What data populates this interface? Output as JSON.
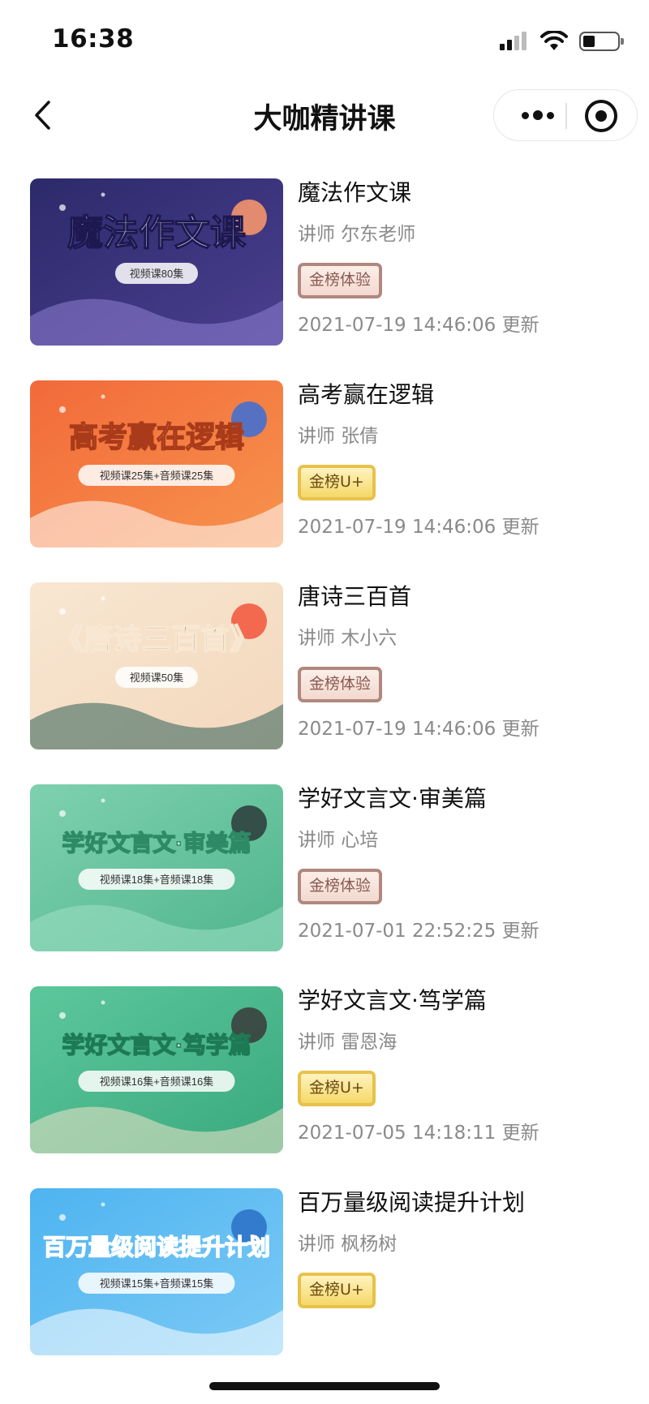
{
  "status_bar": {
    "time": "16:38"
  },
  "nav": {
    "title": "大咖精讲课"
  },
  "courses": [
    {
      "title": "魔法作文课",
      "teacher": "讲师 尔东老师",
      "badge": "金榜体验",
      "badge_type": "trial",
      "updated": "2021-07-19 14:46:06 更新",
      "cover_text": "魔法作文课",
      "cover_sub": "视频课80集",
      "theme": "night"
    },
    {
      "title": "高考赢在逻辑",
      "teacher": "讲师 张倩",
      "badge": "金榜U+",
      "badge_type": "plus",
      "updated": "2021-07-19 14:46:06 更新",
      "cover_text": "高考赢在逻辑",
      "cover_sub": "视频课25集+音频课25集",
      "theme": "orange"
    },
    {
      "title": "唐诗三百首",
      "teacher": "讲师 木小六",
      "badge": "金榜体验",
      "badge_type": "trial",
      "updated": "2021-07-19 14:46:06 更新",
      "cover_text": "《唐诗三百首》",
      "cover_sub": "视频课50集",
      "theme": "cream"
    },
    {
      "title": "学好文言文·审美篇",
      "teacher": "讲师 心培",
      "badge": "金榜体验",
      "badge_type": "trial",
      "updated": "2021-07-01 22:52:25 更新",
      "cover_text": "学好文言文·审美篇",
      "cover_sub": "视频课18集+音频课18集",
      "theme": "mint"
    },
    {
      "title": "学好文言文·笃学篇",
      "teacher": "讲师 雷恩海",
      "badge": "金榜U+",
      "badge_type": "plus",
      "updated": "2021-07-05 14:18:11 更新",
      "cover_text": "学好文言文·笃学篇",
      "cover_sub": "视频课16集+音频课16集",
      "theme": "green"
    },
    {
      "title": "百万量级阅读提升计划",
      "teacher": "讲师 枫杨树",
      "badge": "金榜U+",
      "badge_type": "plus",
      "updated": "",
      "cover_text": "百万量级阅读提升计划",
      "cover_sub": "视频课15集+音频课15集",
      "theme": "blue"
    }
  ],
  "colors": {
    "text_primary": "#111111",
    "text_secondary": "#8a8a8a",
    "badge_trial_border": "#b0887f",
    "badge_plus_border": "#e7c24b"
  }
}
